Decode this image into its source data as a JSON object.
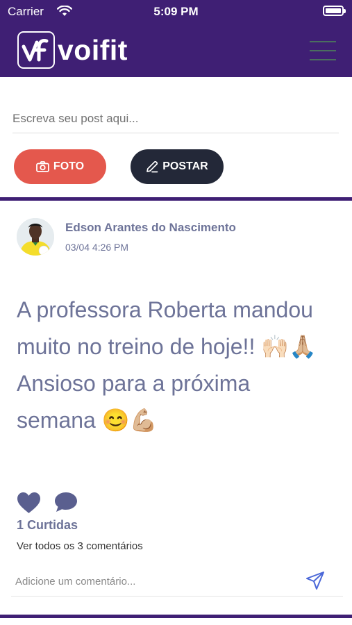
{
  "status": {
    "carrier": "Carrier",
    "time": "5:09 PM"
  },
  "header": {
    "logo_text": "voifit",
    "logo_icon": "vf-logo-icon",
    "menu_icon": "hamburger-menu-icon"
  },
  "composer": {
    "placeholder": "Escreva seu post aqui...",
    "photo_label": "FOTO",
    "photo_icon": "camera-icon",
    "post_label": "POSTAR",
    "post_icon": "pencil-icon"
  },
  "post": {
    "author": "Edson Arantes do Nascimento",
    "time": "03/04 4:26 PM",
    "text": "A professora Roberta mandou muito no treino de hoje!! 🙌🏻🙏🏼 Ansioso para a próxima semana 😊💪🏼",
    "likes_count": "1",
    "likes_label": "Curtidas",
    "view_comments": "Ver todos os 3 comentários",
    "comment_placeholder": "Adicione um comentário..."
  },
  "colors": {
    "brand": "#3f1f74",
    "foto_button": "#e4584d",
    "post_button": "#232838",
    "text_accent": "#6d7398"
  }
}
